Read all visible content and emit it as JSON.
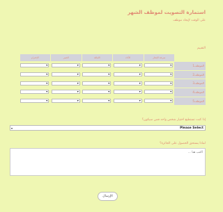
{
  "form": {
    "title": "استمارة التصويت لموظف الشهر",
    "subtitle": "على الوقت لإيجاد موظف",
    "section_label": "التقييم",
    "grid": {
      "columns": [
        "سرعة الإنجاز",
        "الأداء",
        "اللياقة",
        "الصبر",
        "الإحترام"
      ],
      "rows": [
        "الموظف1",
        "الموظف2",
        "الموظف3",
        "الموظف4",
        "الموظف5"
      ]
    },
    "question1": "إذا كنت تستطيع اختيار شخص واحد فمن سيكون؟",
    "select_value": "Please Select",
    "question2": "لماذا يستحق الحصول على الجائزة؟",
    "textarea_placeholder": "اكتب هنا ...",
    "submit_label": "الإرسال"
  }
}
